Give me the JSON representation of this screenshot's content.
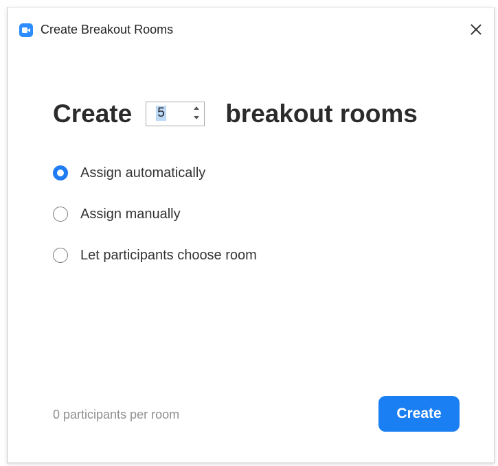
{
  "window": {
    "title": "Create Breakout Rooms",
    "app_icon": "zoom-camera-icon",
    "close_icon": "close-icon"
  },
  "create_row": {
    "prefix": "Create",
    "room_count": "5",
    "suffix": "breakout rooms"
  },
  "options": [
    {
      "label": "Assign automatically",
      "checked": true
    },
    {
      "label": "Assign manually",
      "checked": false
    },
    {
      "label": "Let participants choose room",
      "checked": false
    }
  ],
  "footer": {
    "participants_text": "0 participants per room",
    "create_button_label": "Create"
  },
  "colors": {
    "accent": "#1a7ff2",
    "app_icon": "#2d8cff",
    "muted_text": "#8e8e8e"
  }
}
